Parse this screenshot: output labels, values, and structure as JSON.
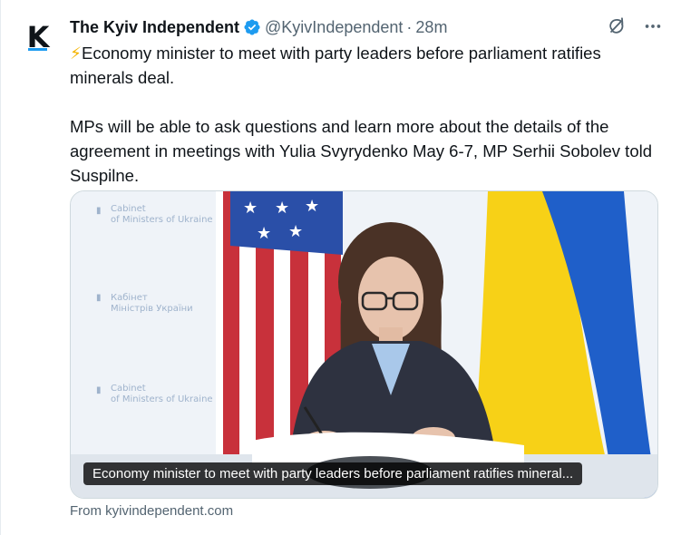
{
  "tweet": {
    "author_name": "The Kyiv Independent",
    "handle": "@KyivIndependent",
    "separator": "·",
    "time": "28m",
    "avatar_letter": "K",
    "bolt_emoji": "⚡",
    "paragraph1": "Economy minister to meet with party leaders before parliament ratifies minerals deal.",
    "paragraph2": "MPs will be able to ask questions and learn more about the details of the agreement in meetings with Yulia Svyrydenko May 6-7, MP Serhii Sobolev told Suspilne.",
    "card": {
      "caption": "Economy minister to meet with party leaders before parliament ratifies mineral...",
      "source": "From kyivindependent.com",
      "backdrop_text_1": "Cabinet",
      "backdrop_text_2": "of Ministers of Ukraine",
      "backdrop_text_3": "Кабінет",
      "backdrop_text_4": "Міністрів України"
    }
  },
  "icons": {
    "verified": "verified-badge-icon",
    "grok": "grok-icon",
    "more": "more-icon"
  },
  "colors": {
    "accent": "#1d9bf0",
    "secondary_text": "#536471",
    "flag_blue": "#1f5fc9",
    "flag_yellow": "#f7d117"
  }
}
